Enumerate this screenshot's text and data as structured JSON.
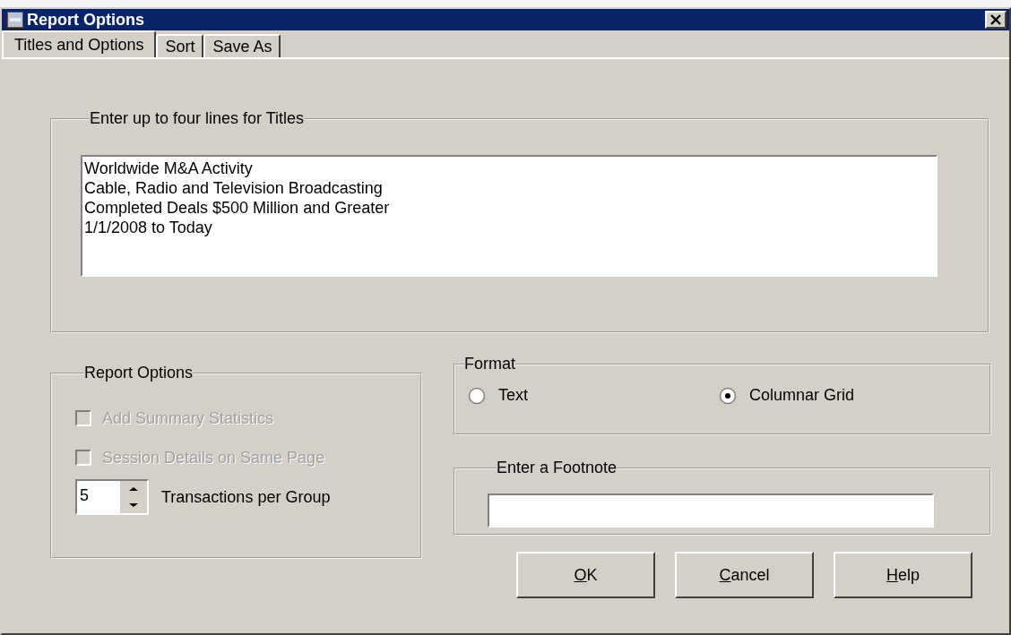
{
  "window": {
    "title": "Report Options"
  },
  "tabs": [
    {
      "label": "Titles and Options",
      "selected": true
    },
    {
      "label": "Sort",
      "selected": false
    },
    {
      "label": "Save As",
      "selected": false
    }
  ],
  "titles": {
    "legend": "Enter up to four lines for Titles",
    "lines": [
      "Worldwide M&A Activity",
      "Cable, Radio and Television Broadcasting",
      "Completed Deals $500 Million and Greater",
      "1/1/2008 to Today"
    ]
  },
  "report_options": {
    "legend": "Report Options",
    "checkboxes": [
      {
        "label": "Add Summary Statistics",
        "checked": false,
        "disabled": true
      },
      {
        "label": "Session Details on Same Page",
        "checked": false,
        "disabled": true
      }
    ],
    "spinner": {
      "value": "5",
      "label": "Transactions per Group"
    }
  },
  "format": {
    "legend": "Format",
    "options": [
      {
        "label": "Text",
        "selected": false
      },
      {
        "label": "Columnar Grid",
        "selected": true
      }
    ]
  },
  "footnote": {
    "legend": "Enter a Footnote"
  },
  "buttons": [
    "OK",
    "Cancel",
    "Help"
  ]
}
